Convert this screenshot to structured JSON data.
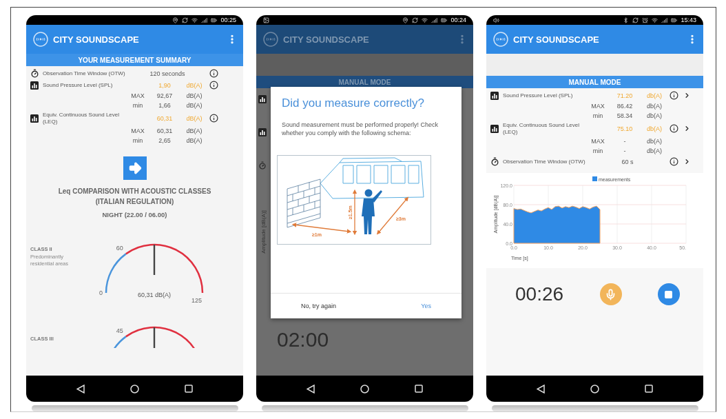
{
  "phones": [
    {
      "kind": "summary",
      "status": {
        "time": "00:25"
      },
      "app_title": "CITY SOUNDSCAPE",
      "section_title": "YOUR MEASUREMENT SUMMARY",
      "rows": [
        {
          "kind": "time",
          "label": "Observation Time Window (OTW)",
          "value": "120 seconds",
          "chevron": false
        },
        {
          "kind": "metric",
          "label": "Sound Pressure Level (SPL)",
          "value": "1,90",
          "unit": "dB(A)",
          "chevron": false,
          "stats": [
            {
              "label": "MAX",
              "value": "92,67",
              "unit": "dB(A)"
            },
            {
              "label": "min",
              "value": "1,66",
              "unit": "dB(A)"
            }
          ]
        },
        {
          "kind": "metric",
          "label": "Equiv. Continuous Sound Level (LEQ)",
          "value": "60,31",
          "unit": "dB(A)",
          "chevron": false,
          "stats": [
            {
              "label": "MAX",
              "value": "60,31",
              "unit": "dB(A)"
            },
            {
              "label": "min",
              "value": "2,65",
              "unit": "dB(A)"
            }
          ]
        }
      ],
      "comparison_title": "Leq COMPARISON WITH ACOUSTIC CLASSES (ITALIAN REGULATION)",
      "period": "NIGHT (22.00 / 06.00)",
      "gauges": [
        {
          "title": "CLASS II",
          "description": "Predominantly residential areas",
          "scale_min": "0",
          "threshold": "60",
          "scale_max": "125",
          "reading": "60,31 dB(A)",
          "level": 0.5
        },
        {
          "title": "CLASS III",
          "threshold": "45",
          "level": 0.5
        }
      ]
    },
    {
      "kind": "dialog",
      "status": {
        "time": "00:24"
      },
      "app_title": "CITY SOUNDSCAPE",
      "section_title": "MANUAL MODE",
      "axis_label": "Amplitude [dB(A)]",
      "timer": "02:00",
      "dialog": {
        "title": "Did you measure correctly?",
        "message": "Sound measurement must be performed properly! Check whether you comply with the following schema:",
        "scheme_labels": [
          "≥1m",
          "≥1.5m",
          "≥3m"
        ],
        "buttons": [
          {
            "label": "No, try again",
            "kind": "text"
          },
          {
            "label": "Yes",
            "kind": "primary"
          }
        ]
      }
    },
    {
      "kind": "manual",
      "status": {
        "time": "15:43"
      },
      "app_title": "CITY SOUNDSCAPE",
      "section_title": "MANUAL MODE",
      "rows": [
        {
          "kind": "metric",
          "label": "Sound Pressure Level (SPL)",
          "value": "71.20",
          "unit": "db(A)",
          "chevron": true,
          "stats": [
            {
              "label": "MAX",
              "value": "86.42",
              "unit": "db(A)"
            },
            {
              "label": "min",
              "value": "58.34",
              "unit": "db(A)"
            }
          ]
        },
        {
          "kind": "metric",
          "label": "Equiv. Continuous Sound Level (LEQ)",
          "value": "75.10",
          "unit": "db(A)",
          "chevron": true,
          "stats": [
            {
              "label": "MAX",
              "value": "-",
              "unit": "db(A)"
            },
            {
              "label": "min",
              "value": "-",
              "unit": "db(A)"
            }
          ]
        },
        {
          "kind": "time",
          "label": "Observation Time Window (OTW)",
          "value": "60 s",
          "chevron": true
        }
      ],
      "chart_data": {
        "type": "area",
        "grid": true,
        "xlabel": "Time [s]",
        "ylabel": "Amplitude [dB(A)]",
        "x": [
          0,
          1,
          2,
          3,
          4,
          5,
          6,
          7,
          8,
          9,
          10,
          11,
          12,
          13,
          14,
          15,
          16,
          17,
          18,
          19,
          20,
          21,
          22,
          23,
          24,
          25
        ],
        "series": [
          {
            "name": "measurements",
            "color": "#2f8ae5",
            "values": [
              72,
              70,
              71,
              68,
              65,
              63,
              66,
              69,
              67,
              71,
              74,
              70,
              76,
              77,
              73,
              76,
              74,
              77,
              75,
              72,
              76,
              74,
              71,
              75,
              77,
              70
            ]
          }
        ],
        "xlim": [
          0,
          50
        ],
        "ylim": [
          0,
          120
        ],
        "xticks": [
          {
            "value": 0,
            "label": "0.0"
          },
          {
            "value": 10,
            "label": "10.0"
          },
          {
            "value": 20,
            "label": "20.0"
          },
          {
            "value": 30,
            "label": "30.0"
          },
          {
            "value": 40,
            "label": "40.0"
          },
          {
            "value": 50,
            "label": "50."
          }
        ],
        "yticks": [
          {
            "value": 0,
            "label": "0.0"
          },
          {
            "value": 40,
            "label": "40.0"
          },
          {
            "value": 80,
            "label": "80.0"
          },
          {
            "value": 120,
            "label": "120.0"
          }
        ]
      },
      "timer": "00:26"
    }
  ]
}
